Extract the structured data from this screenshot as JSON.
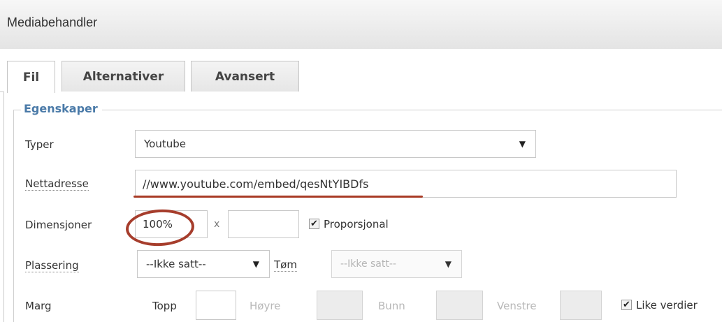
{
  "window": {
    "title": "Mediabehandler"
  },
  "tabs": [
    {
      "label": "Fil",
      "active": true
    },
    {
      "label": "Alternativer",
      "active": false
    },
    {
      "label": "Avansert",
      "active": false
    }
  ],
  "properties": {
    "legend": "Egenskaper",
    "type": {
      "label": "Typer",
      "value": "Youtube"
    },
    "url": {
      "label": "Nettadresse",
      "value": "//www.youtube.com/embed/qesNtYIBDfs"
    },
    "dimensions": {
      "label": "Dimensjoner",
      "width": "100%",
      "separator": "x",
      "height": "",
      "proportional_label": "Proporsjonal",
      "proportional_checked": true
    },
    "placement": {
      "label": "Plassering",
      "value": "--Ikke satt--",
      "clear_label": "Tøm",
      "secondary_value": "--Ikke satt--"
    },
    "margin": {
      "label": "Marg",
      "top_label": "Topp",
      "top_value": "",
      "right_label": "Høyre",
      "bottom_label": "Bunn",
      "left_label": "Venstre",
      "equal_label": "Like verdier",
      "equal_checked": true
    }
  },
  "icons": {
    "dropdown": "triangle-down-icon",
    "check": "checkmark-icon"
  },
  "colors": {
    "legend": "#4a7aa8",
    "annotation": "#a83a25"
  }
}
